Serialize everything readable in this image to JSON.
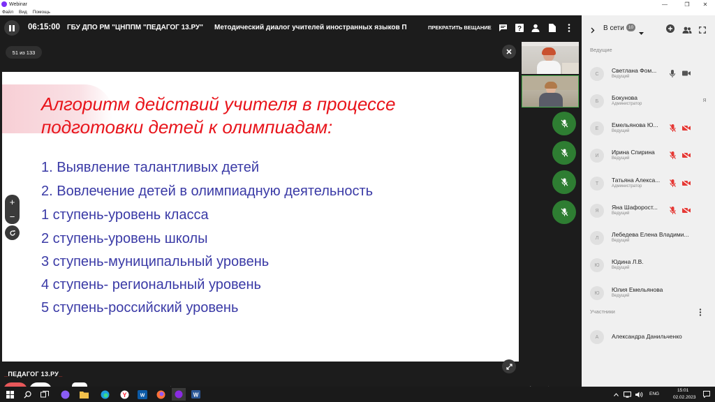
{
  "window": {
    "app_title": "Webinar"
  },
  "menu": [
    "Файл",
    "Вид",
    "Помощь"
  ],
  "topbar": {
    "timer": "06:15:00",
    "organization": "ГБУ ДПО РМ \"ЦНППМ \"ПЕДАГОГ 13.РУ\"",
    "event_title": "Методический диалог учителей иностранных языков П",
    "stop_label": "ПРЕКРАТИТЬ ВЕЩАНИЕ"
  },
  "slide": {
    "counter": "51 из 133",
    "title_line1": "Алгоритм действий учителя в процессе",
    "title_line2": "подготовки детей к олимпиадам:",
    "items": [
      "1.  Выявление талантливых детей",
      "2.  Вовлечение детей в олимпиадную деятельность",
      "1 ступень-уровень класса",
      "2 ступень-уровень школы",
      "3 ступень-муниципальный уровень",
      "4 ступень- региональный уровень",
      "5 ступень-российский уровень"
    ]
  },
  "logo": {
    "text": "ПЕДАГОГ 13.РУ"
  },
  "controls": {
    "volume_level": 0.4
  },
  "panel": {
    "online_label": "В сети",
    "online_count": "10",
    "hosts_title": "Ведущие",
    "participants_title": "Участники",
    "hosts": [
      {
        "initial": "С",
        "name": "Светлана Фом...",
        "role": "Ведущий"
      },
      {
        "initial": "Б",
        "name": "Бокунова",
        "role": "Администратор"
      },
      {
        "initial": "Е",
        "name": "Емельянова Ю...",
        "role": "Ведущий"
      },
      {
        "initial": "И",
        "name": "Ирина Спирина",
        "role": "Ведущий"
      },
      {
        "initial": "Т",
        "name": "Татьяна Алекса...",
        "role": "Администратор"
      },
      {
        "initial": "Я",
        "name": "Яна Шафорост...",
        "role": "Ведущий"
      },
      {
        "initial": "Л",
        "name": "Лебедева Елена Владими...",
        "role": "Ведущий"
      },
      {
        "initial": "Ю",
        "name": "Юдина Л.В.",
        "role": "Ведущий"
      },
      {
        "initial": "Ю",
        "name": "Юлия Емельянова",
        "role": "Ведущий"
      }
    ],
    "participants": [
      {
        "initial": "А",
        "name": "Александра Данильченко"
      }
    ],
    "typing_initial": "Я"
  },
  "taskbar": {
    "language": "ENG",
    "time": "15:01",
    "date": "02.02.2023"
  }
}
